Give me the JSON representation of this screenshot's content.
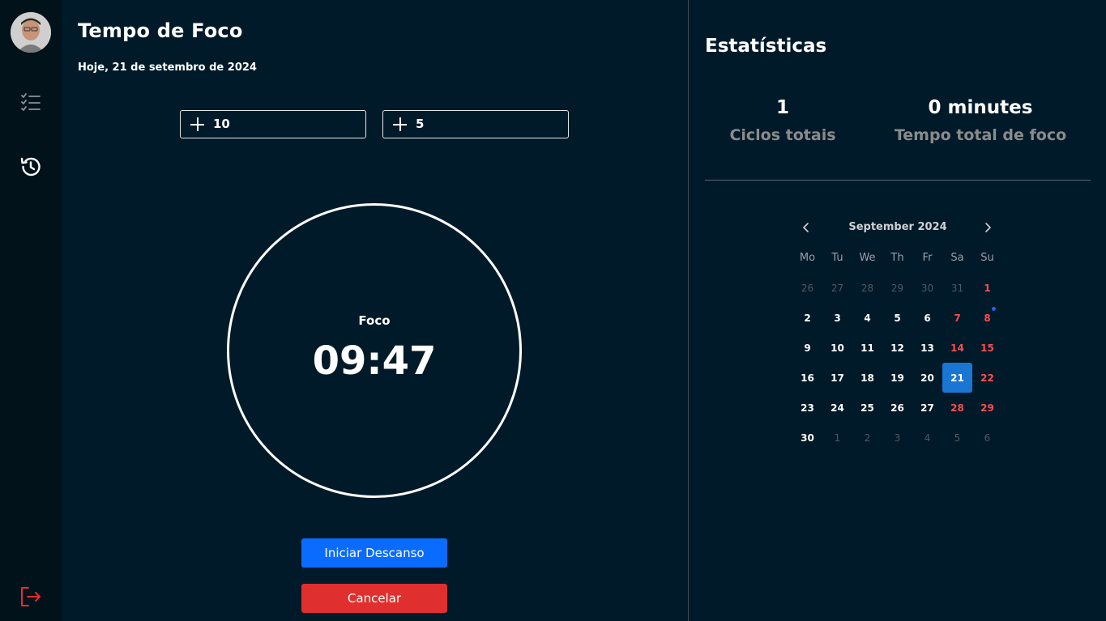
{
  "sidebar": {
    "avatar": "user-avatar",
    "icons": [
      "tasks-checklist-icon",
      "history-icon",
      "logout-icon"
    ],
    "logout_color": "#e02f2f"
  },
  "main": {
    "title": "Tempo de Foco",
    "date": "Hoje, 21 de setembro de 2024",
    "increment_fields": [
      {
        "value": "10"
      },
      {
        "value": "5"
      }
    ],
    "timer": {
      "label": "Foco",
      "time": "09:47"
    },
    "buttons": {
      "start_break": "Iniciar Descanso",
      "cancel": "Cancelar"
    },
    "colors": {
      "primary": "#0a6cff",
      "danger": "#e02f2f"
    }
  },
  "stats": {
    "title": "Estatísticas",
    "total_cycles": {
      "value": "1",
      "label": "Ciclos totais"
    },
    "total_focus": {
      "value": "0 minutes",
      "label": "Tempo total de foco"
    }
  },
  "calendar": {
    "month": "September 2024",
    "weekdays": [
      "Mo",
      "Tu",
      "We",
      "Th",
      "Fr",
      "Sa",
      "Su"
    ],
    "weeks": [
      [
        {
          "d": "26",
          "m": true
        },
        {
          "d": "27",
          "m": true
        },
        {
          "d": "28",
          "m": true
        },
        {
          "d": "29",
          "m": true
        },
        {
          "d": "30",
          "m": true
        },
        {
          "d": "31",
          "m": true
        },
        {
          "d": "1",
          "w": true
        }
      ],
      [
        {
          "d": "2"
        },
        {
          "d": "3"
        },
        {
          "d": "4"
        },
        {
          "d": "5"
        },
        {
          "d": "6"
        },
        {
          "d": "7",
          "w": true
        },
        {
          "d": "8",
          "w": true,
          "dot": true
        }
      ],
      [
        {
          "d": "9"
        },
        {
          "d": "10"
        },
        {
          "d": "11"
        },
        {
          "d": "12"
        },
        {
          "d": "13"
        },
        {
          "d": "14",
          "w": true
        },
        {
          "d": "15",
          "w": true
        }
      ],
      [
        {
          "d": "16"
        },
        {
          "d": "17"
        },
        {
          "d": "18"
        },
        {
          "d": "19"
        },
        {
          "d": "20"
        },
        {
          "d": "21",
          "sel": true
        },
        {
          "d": "22",
          "w": true
        }
      ],
      [
        {
          "d": "23"
        },
        {
          "d": "24"
        },
        {
          "d": "25"
        },
        {
          "d": "26"
        },
        {
          "d": "27"
        },
        {
          "d": "28",
          "w": true
        },
        {
          "d": "29",
          "w": true
        }
      ],
      [
        {
          "d": "30"
        },
        {
          "d": "1",
          "m": true
        },
        {
          "d": "2",
          "m": true
        },
        {
          "d": "3",
          "m": true
        },
        {
          "d": "4",
          "m": true
        },
        {
          "d": "5",
          "m": true
        },
        {
          "d": "6",
          "m": true
        }
      ]
    ],
    "selected_color": "#1976d2",
    "weekend_color": "#ff4d4f",
    "event_dot_color": "#2563eb"
  }
}
